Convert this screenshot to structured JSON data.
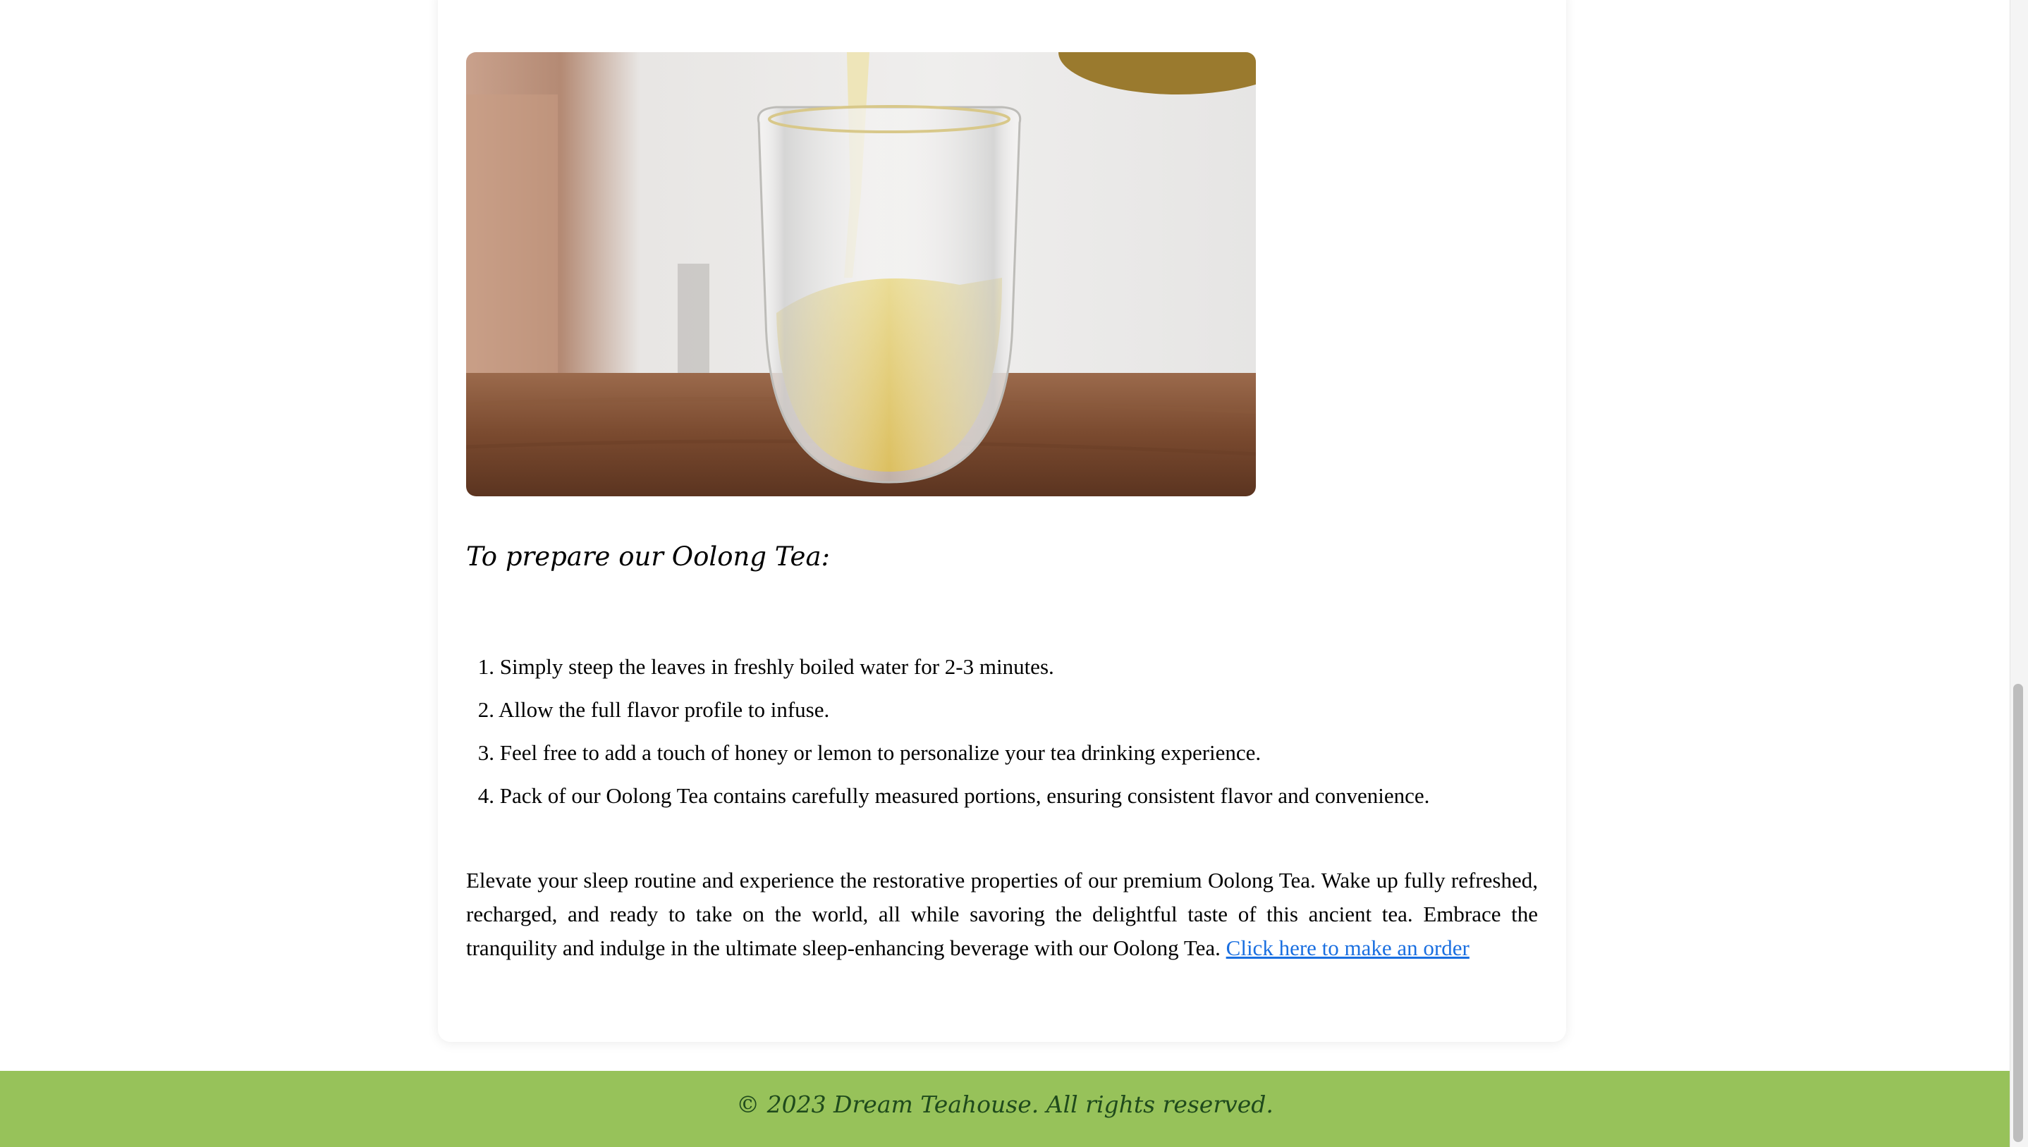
{
  "image": {
    "alt": "Glass of oolong tea being poured",
    "icon": "tea-pour-photo"
  },
  "preparation": {
    "heading": "To prepare our Oolong Tea:",
    "steps": [
      {
        "number": "1.",
        "text": "Simply steep the leaves in freshly boiled water for 2-3 minutes."
      },
      {
        "number": "2.",
        "text": "Allow the full flavor profile to infuse."
      },
      {
        "number": "3.",
        "text": "Feel free to add a touch of honey or lemon to personalize your tea drinking experience."
      },
      {
        "number": "4.",
        "text": "Pack of our Oolong Tea contains carefully measured portions, ensuring consistent flavor and convenience."
      }
    ]
  },
  "closing": {
    "text": "Elevate your sleep routine and experience the restorative properties of our premium Oolong Tea. Wake up fully refreshed, recharged, and ready to take on the world, all while savoring the delightful taste of this ancient tea. Embrace the tranquility and indulge in the ultimate sleep-enhancing beverage with our Oolong Tea.",
    "link_label": "Click here to make an order"
  },
  "footer": {
    "text": "© 2023 Dream Teahouse. All rights reserved."
  },
  "colors": {
    "footer_bg": "#97c25a",
    "footer_text": "#1f4a1c",
    "link": "#1a6fe0"
  }
}
